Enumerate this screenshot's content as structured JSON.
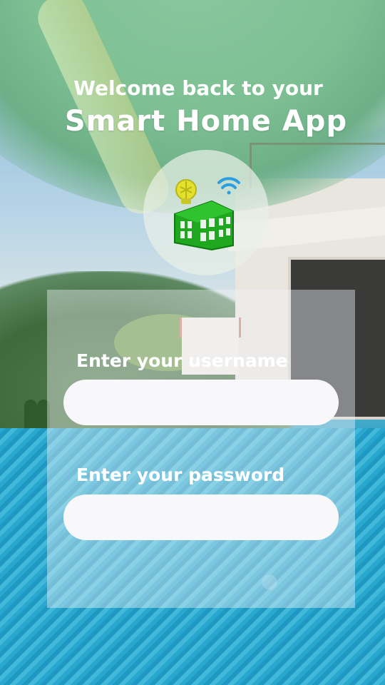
{
  "header": {
    "welcome_text": "Welcome back to your",
    "app_name": "Smart Home App"
  },
  "logo": {
    "icons": [
      "wifi-icon",
      "lightbulb-icon",
      "building-icon"
    ],
    "colors": {
      "building": "#1fa81f",
      "bulb": "#e3e12b",
      "wifi": "#2a9ee0"
    }
  },
  "login_form": {
    "username_label": "Enter your username",
    "username_value": "",
    "password_label": "Enter your password",
    "password_value": ""
  }
}
